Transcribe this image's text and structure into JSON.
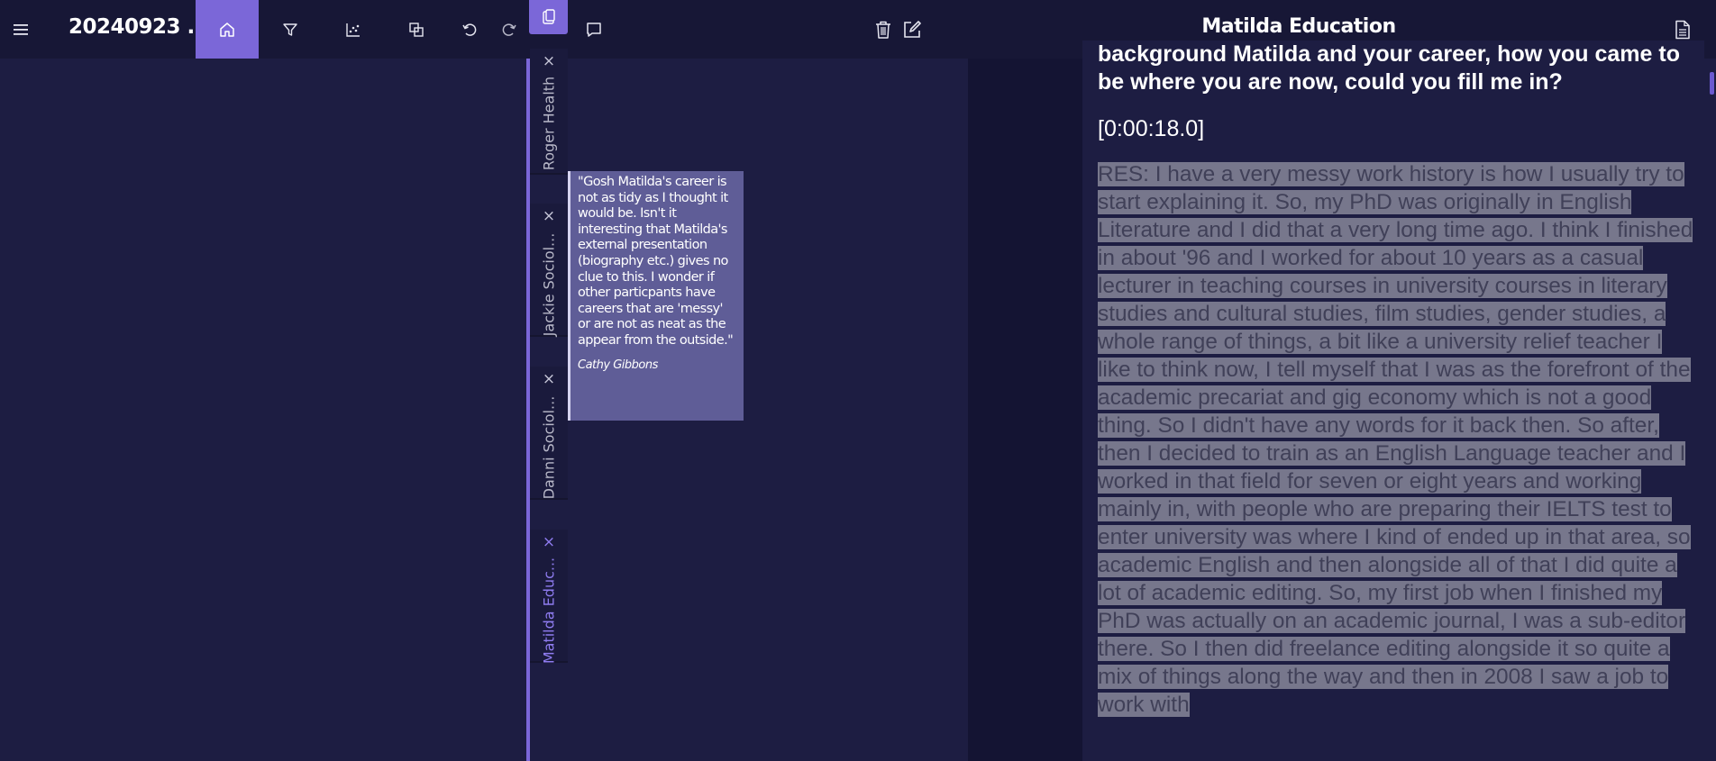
{
  "header": {
    "doc_title": "20240923 ...",
    "app_title": "Matilda Education",
    "icons": {
      "menu": "hamburger-menu-icon",
      "home": "home-icon",
      "filter": "filter-icon",
      "chart": "scatter-chart-icon",
      "copy": "copy-icon",
      "undo": "undo-icon",
      "redo": "redo-icon",
      "clipboard": "clipboard-icon",
      "comment": "comment-icon",
      "delete": "trash-icon",
      "edit": "edit-icon",
      "document": "document-icon"
    },
    "accent_color": "#7b67d8"
  },
  "tabs": [
    {
      "label": "Roger Health",
      "close": "×",
      "active": false
    },
    {
      "label": "Jackie Sociol...",
      "close": "×",
      "active": false
    },
    {
      "label": "Danni Sociol...",
      "close": "×",
      "active": false
    },
    {
      "label": "Matilda Educ...",
      "close": "×",
      "active": true
    }
  ],
  "comment": {
    "text": "\"Gosh Matilda's career is not as tidy as I thought it would be. Isn't it interesting that Matilda's external presentation (biography etc.) gives no clue to this. I wonder if other particpants have careers that are 'messy' or are not as neat as the appear from the outside.\"",
    "author": "Cathy Gibbons"
  },
  "transcript": {
    "question": "background Matilda and your career, how you came to be where you are now, could you fill me in?",
    "timestamp": "[0:00:18.0]",
    "answer": "RES: I have a very messy work history is how I usually try to start explaining it.  So, my PhD was originally in English Literature and I did that a very long time ago. I think I finished in about '96 and I worked for about 10 years as a casual lecturer in teaching courses in university courses in literary studies and cultural studies, film studies, gender studies, a whole range of things, a bit like a university relief teacher I like to think now, I tell myself that I was as the forefront of the academic precariat and gig economy which is not a good thing. So I didn't have any words for it back then.  So after, then I decided to train as an English Language teacher and I worked in that field for seven or eight years and working mainly in, with people who are preparing their IELTS test to enter university was where I kind of ended up in that area, so academic English and then alongside all of that I did quite a lot of academic editing.  So, my first job when I finished my PhD was actually on an academic journal, I was a sub-editor there. So I then did freelance editing alongside it so quite a mix of things along the way and then in 2008 I saw a job to work with"
  }
}
